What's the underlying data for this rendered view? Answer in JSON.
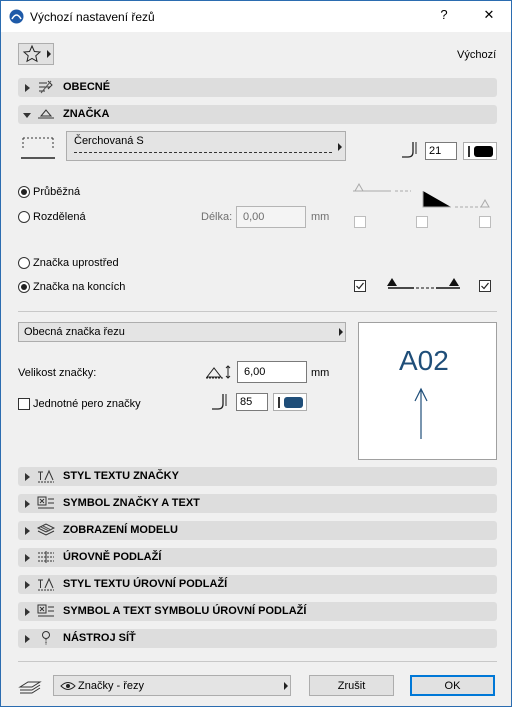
{
  "window": {
    "title": "Výchozí nastavení řezů",
    "help": "?",
    "close": "✕"
  },
  "favorites": {
    "label": "Výchozí"
  },
  "sections": {
    "general": "OBECNÉ",
    "marker": "ZNAČKA",
    "marker_text_style": "STYL TEXTU ZNAČKY",
    "marker_symbol": "SYMBOL ZNAČKY A TEXT",
    "model_display": "ZOBRAZENÍ MODELU",
    "story_levels": "ÚROVNĚ PODLAŽÍ",
    "story_text_style": "STYL TEXTU ÚROVNÍ PODLAŽÍ",
    "story_symbol": "SYMBOL A TEXT SYMBOLU ÚROVNÍ PODLAŽÍ",
    "grid_tool": "NÁSTROJ SÍŤ"
  },
  "marker": {
    "line_type": "Čerchovaná S",
    "pen": "21",
    "continuous": "Průběžná",
    "segmented": "Rozdělená",
    "length_label": "Délka:",
    "length_value": "0,00",
    "length_unit": "mm",
    "in_middle": "Značka uprostřed",
    "at_ends": "Značka na koncích"
  },
  "marker_type": {
    "name": "Obecná značka řezu",
    "size_label": "Velikost značky:",
    "size_value": "6,00",
    "size_unit": "mm",
    "uniform_pen": "Jednotné pero značky",
    "pen": "85",
    "preview_text": "A02"
  },
  "footer": {
    "layer": "Značky - řezy",
    "cancel": "Zrušit",
    "ok": "OK"
  },
  "colors": {
    "accent": "#1f4e79",
    "ok_border": "#0078d7"
  }
}
